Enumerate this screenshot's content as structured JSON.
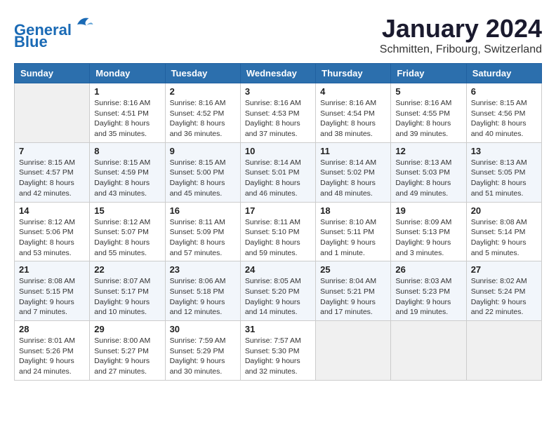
{
  "header": {
    "logo_line1": "General",
    "logo_line2": "Blue",
    "title": "January 2024",
    "subtitle": "Schmitten, Fribourg, Switzerland"
  },
  "weekdays": [
    "Sunday",
    "Monday",
    "Tuesday",
    "Wednesday",
    "Thursday",
    "Friday",
    "Saturday"
  ],
  "weeks": [
    [
      {
        "day": "",
        "info": ""
      },
      {
        "day": "1",
        "info": "Sunrise: 8:16 AM\nSunset: 4:51 PM\nDaylight: 8 hours\nand 35 minutes."
      },
      {
        "day": "2",
        "info": "Sunrise: 8:16 AM\nSunset: 4:52 PM\nDaylight: 8 hours\nand 36 minutes."
      },
      {
        "day": "3",
        "info": "Sunrise: 8:16 AM\nSunset: 4:53 PM\nDaylight: 8 hours\nand 37 minutes."
      },
      {
        "day": "4",
        "info": "Sunrise: 8:16 AM\nSunset: 4:54 PM\nDaylight: 8 hours\nand 38 minutes."
      },
      {
        "day": "5",
        "info": "Sunrise: 8:16 AM\nSunset: 4:55 PM\nDaylight: 8 hours\nand 39 minutes."
      },
      {
        "day": "6",
        "info": "Sunrise: 8:15 AM\nSunset: 4:56 PM\nDaylight: 8 hours\nand 40 minutes."
      }
    ],
    [
      {
        "day": "7",
        "info": "Sunrise: 8:15 AM\nSunset: 4:57 PM\nDaylight: 8 hours\nand 42 minutes."
      },
      {
        "day": "8",
        "info": "Sunrise: 8:15 AM\nSunset: 4:59 PM\nDaylight: 8 hours\nand 43 minutes."
      },
      {
        "day": "9",
        "info": "Sunrise: 8:15 AM\nSunset: 5:00 PM\nDaylight: 8 hours\nand 45 minutes."
      },
      {
        "day": "10",
        "info": "Sunrise: 8:14 AM\nSunset: 5:01 PM\nDaylight: 8 hours\nand 46 minutes."
      },
      {
        "day": "11",
        "info": "Sunrise: 8:14 AM\nSunset: 5:02 PM\nDaylight: 8 hours\nand 48 minutes."
      },
      {
        "day": "12",
        "info": "Sunrise: 8:13 AM\nSunset: 5:03 PM\nDaylight: 8 hours\nand 49 minutes."
      },
      {
        "day": "13",
        "info": "Sunrise: 8:13 AM\nSunset: 5:05 PM\nDaylight: 8 hours\nand 51 minutes."
      }
    ],
    [
      {
        "day": "14",
        "info": "Sunrise: 8:12 AM\nSunset: 5:06 PM\nDaylight: 8 hours\nand 53 minutes."
      },
      {
        "day": "15",
        "info": "Sunrise: 8:12 AM\nSunset: 5:07 PM\nDaylight: 8 hours\nand 55 minutes."
      },
      {
        "day": "16",
        "info": "Sunrise: 8:11 AM\nSunset: 5:09 PM\nDaylight: 8 hours\nand 57 minutes."
      },
      {
        "day": "17",
        "info": "Sunrise: 8:11 AM\nSunset: 5:10 PM\nDaylight: 8 hours\nand 59 minutes."
      },
      {
        "day": "18",
        "info": "Sunrise: 8:10 AM\nSunset: 5:11 PM\nDaylight: 9 hours\nand 1 minute."
      },
      {
        "day": "19",
        "info": "Sunrise: 8:09 AM\nSunset: 5:13 PM\nDaylight: 9 hours\nand 3 minutes."
      },
      {
        "day": "20",
        "info": "Sunrise: 8:08 AM\nSunset: 5:14 PM\nDaylight: 9 hours\nand 5 minutes."
      }
    ],
    [
      {
        "day": "21",
        "info": "Sunrise: 8:08 AM\nSunset: 5:15 PM\nDaylight: 9 hours\nand 7 minutes."
      },
      {
        "day": "22",
        "info": "Sunrise: 8:07 AM\nSunset: 5:17 PM\nDaylight: 9 hours\nand 10 minutes."
      },
      {
        "day": "23",
        "info": "Sunrise: 8:06 AM\nSunset: 5:18 PM\nDaylight: 9 hours\nand 12 minutes."
      },
      {
        "day": "24",
        "info": "Sunrise: 8:05 AM\nSunset: 5:20 PM\nDaylight: 9 hours\nand 14 minutes."
      },
      {
        "day": "25",
        "info": "Sunrise: 8:04 AM\nSunset: 5:21 PM\nDaylight: 9 hours\nand 17 minutes."
      },
      {
        "day": "26",
        "info": "Sunrise: 8:03 AM\nSunset: 5:23 PM\nDaylight: 9 hours\nand 19 minutes."
      },
      {
        "day": "27",
        "info": "Sunrise: 8:02 AM\nSunset: 5:24 PM\nDaylight: 9 hours\nand 22 minutes."
      }
    ],
    [
      {
        "day": "28",
        "info": "Sunrise: 8:01 AM\nSunset: 5:26 PM\nDaylight: 9 hours\nand 24 minutes."
      },
      {
        "day": "29",
        "info": "Sunrise: 8:00 AM\nSunset: 5:27 PM\nDaylight: 9 hours\nand 27 minutes."
      },
      {
        "day": "30",
        "info": "Sunrise: 7:59 AM\nSunset: 5:29 PM\nDaylight: 9 hours\nand 30 minutes."
      },
      {
        "day": "31",
        "info": "Sunrise: 7:57 AM\nSunset: 5:30 PM\nDaylight: 9 hours\nand 32 minutes."
      },
      {
        "day": "",
        "info": ""
      },
      {
        "day": "",
        "info": ""
      },
      {
        "day": "",
        "info": ""
      }
    ]
  ]
}
